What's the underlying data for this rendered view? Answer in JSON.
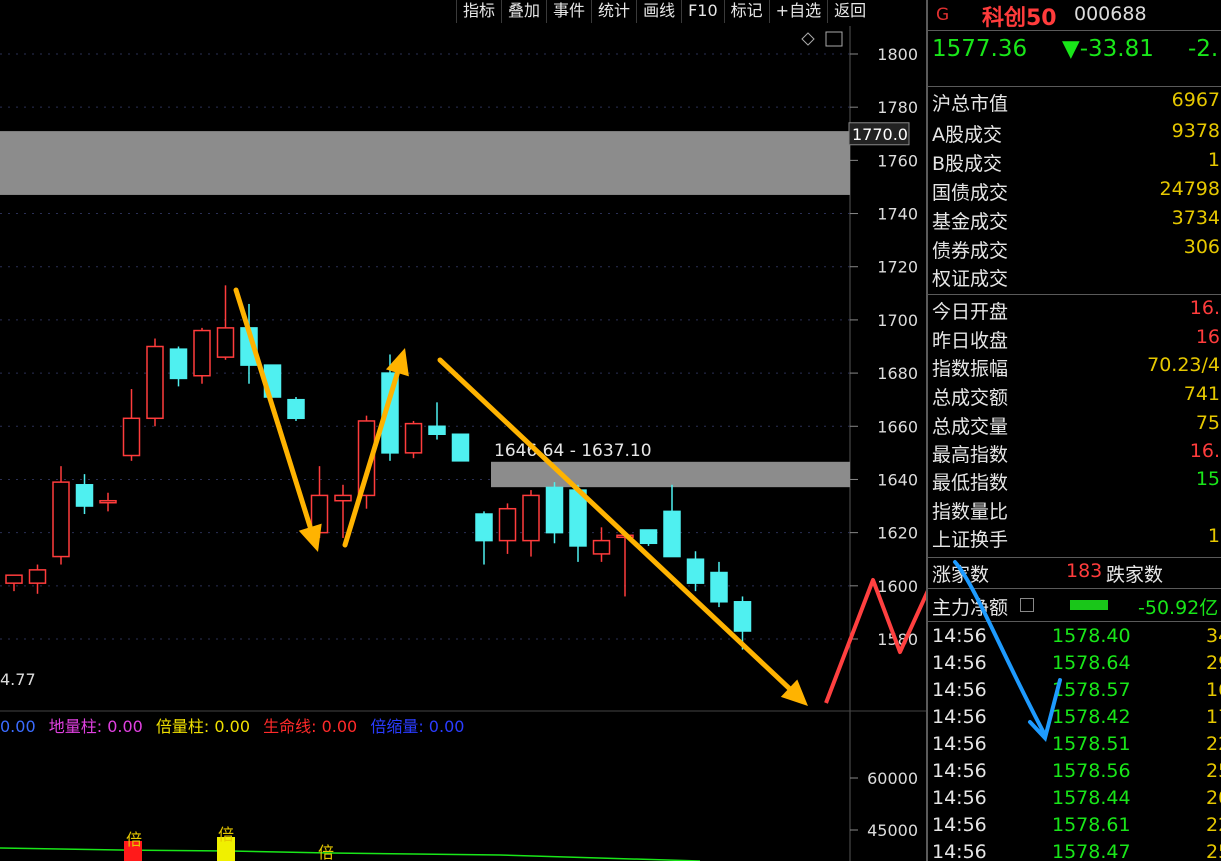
{
  "toolbar": [
    "指标",
    "叠加",
    "事件",
    "统计",
    "画线",
    "F10",
    "标记",
    "+自选",
    "返回"
  ],
  "quote": {
    "g_mark": "G",
    "name": "科创50",
    "code": "000688",
    "price": "1577.36",
    "change": "▼-33.81",
    "pct": "-2."
  },
  "stats": [
    {
      "label": "沪总市值",
      "value": "6967"
    },
    {
      "label": "A股成交",
      "value": "9378"
    },
    {
      "label": "B股成交",
      "value": "1"
    },
    {
      "label": "国债成交",
      "value": "24798"
    },
    {
      "label": "基金成交",
      "value": "3734"
    },
    {
      "label": "债券成交",
      "value": "306"
    },
    {
      "label": "权证成交",
      "value": ""
    },
    {
      "label": "今日开盘",
      "value": "16."
    },
    {
      "label": "昨日收盘",
      "value": "16"
    },
    {
      "label": "指数振幅",
      "value": "70.23/4"
    },
    {
      "label": "总成交额",
      "value": "741"
    },
    {
      "label": "总成交量",
      "value": "75"
    },
    {
      "label": "最高指数",
      "value": "16."
    },
    {
      "label": "最低指数",
      "value": "15"
    },
    {
      "label": "指数量比",
      "value": ""
    },
    {
      "label": "上证换手",
      "value": "1"
    }
  ],
  "advdec": {
    "up_label": "涨家数",
    "up_value": "183",
    "down_label": "跌家数"
  },
  "netflow": {
    "label": "主力净额",
    "value": "-50.92亿"
  },
  "ticks": [
    {
      "t": "14:56",
      "p": "1578.40",
      "v": "34"
    },
    {
      "t": "14:56",
      "p": "1578.64",
      "v": "29"
    },
    {
      "t": "14:56",
      "p": "1578.57",
      "v": "16"
    },
    {
      "t": "14:56",
      "p": "1578.42",
      "v": "17"
    },
    {
      "t": "14:56",
      "p": "1578.51",
      "v": "22"
    },
    {
      "t": "14:56",
      "p": "1578.56",
      "v": "25"
    },
    {
      "t": "14:56",
      "p": "1578.44",
      "v": "20"
    },
    {
      "t": "14:56",
      "p": "1578.61",
      "v": "22"
    },
    {
      "t": "14:56",
      "p": "1578.47",
      "v": "25"
    }
  ],
  "colors": {
    "up": "#ff3c3c",
    "down": "#4ff0f0",
    "accent": "#ffb300",
    "box": "#8c8c8c"
  },
  "chart_data": {
    "type": "candlestick",
    "y_axis_ticks": [
      1800,
      1780,
      1760,
      1740,
      1720,
      1700,
      1680,
      1660,
      1640,
      1620,
      1600,
      1580
    ],
    "ylim": [
      1570,
      1810
    ],
    "price_marker": "1770.0",
    "zone_high": {
      "from": 1747,
      "to": 1771
    },
    "zone_mid": {
      "from": 1637.1,
      "to": 1646.64,
      "label": "1646.64 - 1637.10"
    },
    "left_partial_label": "4.77",
    "candles": [
      {
        "o": 1601,
        "h": 1604,
        "l": 1598,
        "c": 1604
      },
      {
        "o": 1601,
        "h": 1608,
        "l": 1597,
        "c": 1606
      },
      {
        "o": 1611,
        "h": 1645,
        "l": 1608,
        "c": 1639
      },
      {
        "o": 1638,
        "h": 1642,
        "l": 1627,
        "c": 1630
      },
      {
        "o": 1632,
        "h": 1635,
        "l": 1628,
        "c": 1632
      },
      {
        "o": 1649,
        "h": 1674,
        "l": 1647,
        "c": 1663
      },
      {
        "o": 1663,
        "h": 1693,
        "l": 1660,
        "c": 1690
      },
      {
        "o": 1689,
        "h": 1690,
        "l": 1675,
        "c": 1678
      },
      {
        "o": 1679,
        "h": 1697,
        "l": 1676,
        "c": 1696
      },
      {
        "o": 1686,
        "h": 1713,
        "l": 1685,
        "c": 1697
      },
      {
        "o": 1697,
        "h": 1706,
        "l": 1676,
        "c": 1683
      },
      {
        "o": 1683,
        "h": 1683,
        "l": 1671,
        "c": 1671
      },
      {
        "o": 1670,
        "h": 1671,
        "l": 1662,
        "c": 1663
      },
      {
        "o": 1620,
        "h": 1645,
        "l": 1618,
        "c": 1634
      },
      {
        "o": 1632,
        "h": 1638,
        "l": 1618,
        "c": 1634
      },
      {
        "o": 1634,
        "h": 1664,
        "l": 1629,
        "c": 1662
      },
      {
        "o": 1680,
        "h": 1687,
        "l": 1647,
        "c": 1650
      },
      {
        "o": 1650,
        "h": 1662,
        "l": 1648,
        "c": 1661
      },
      {
        "o": 1660,
        "h": 1669,
        "l": 1655,
        "c": 1657
      },
      {
        "o": 1657,
        "h": 1657,
        "l": 1647,
        "c": 1647
      },
      {
        "o": 1627,
        "h": 1628,
        "l": 1608,
        "c": 1617
      },
      {
        "o": 1617,
        "h": 1631,
        "l": 1612,
        "c": 1629
      },
      {
        "o": 1617,
        "h": 1636,
        "l": 1611,
        "c": 1634
      },
      {
        "o": 1637,
        "h": 1639,
        "l": 1616,
        "c": 1620
      },
      {
        "o": 1636,
        "h": 1638,
        "l": 1609,
        "c": 1615
      },
      {
        "o": 1612,
        "h": 1622,
        "l": 1609,
        "c": 1617
      },
      {
        "o": 1619,
        "h": 1620,
        "l": 1596,
        "c": 1619
      },
      {
        "o": 1621,
        "h": 1621,
        "l": 1615,
        "c": 1616
      },
      {
        "o": 1628,
        "h": 1638,
        "l": 1611,
        "c": 1611
      },
      {
        "o": 1610,
        "h": 1613,
        "l": 1598,
        "c": 1601
      },
      {
        "o": 1605,
        "h": 1609,
        "l": 1592,
        "c": 1594
      },
      {
        "o": 1594,
        "h": 1596,
        "l": 1576,
        "c": 1583
      }
    ],
    "indicator_legend": [
      {
        "text": "0.00",
        "color": "#3b6cff"
      },
      {
        "text": "地量柱: 0.00",
        "color": "#e040e0"
      },
      {
        "text": "倍量柱: 0.00",
        "color": "#f0e000"
      },
      {
        "text": "生命线: 0.00",
        "color": "#ff2a2a"
      },
      {
        "text": "倍缩量: 0.00",
        "color": "#2a3cff"
      }
    ],
    "volume_axis_ticks": [
      60000,
      45000
    ],
    "volume_marker_label": "倍"
  }
}
